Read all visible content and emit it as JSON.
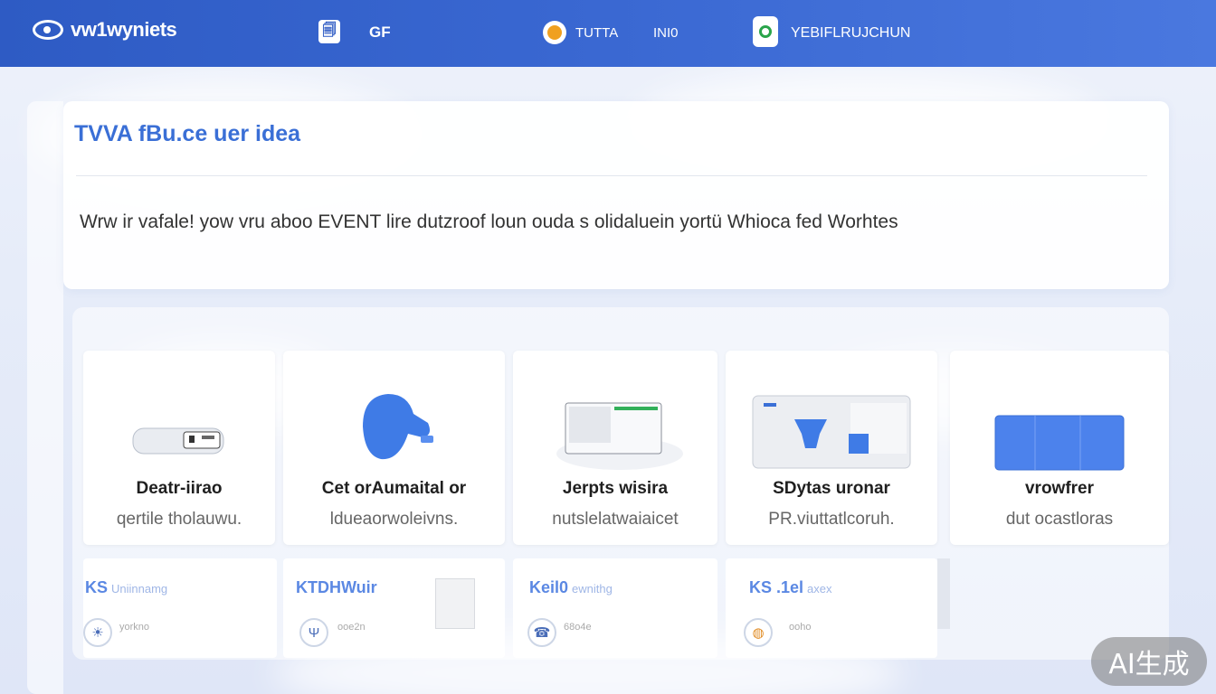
{
  "header": {
    "brand": "vw1wyniets",
    "nav_icon_glyph": "🗐",
    "nav_label": "GF",
    "links": [
      "TUTTA",
      "INI0"
    ],
    "user_name": "YEBIFLRUJCHUN"
  },
  "intro": {
    "title": "TVVA fBu.ce uer idea",
    "text": "Wrw ir vafale! yow vru aboo EVENT lire dutzroof loun ouda s olidaluein yortü Whioca fed Worhtes"
  },
  "products": [
    {
      "title": "Deatr-iirao",
      "subtitle": "qertile tholauwu."
    },
    {
      "title": "Cet orAumaital or",
      "subtitle": "ldueaorwoleivns."
    },
    {
      "title": "Jerpts wisira",
      "subtitle": "nutslelatwaiaicet"
    },
    {
      "title": "SDytas uronar",
      "subtitle": "PR.viuttatlcoruh."
    },
    {
      "title": "vrowfrer",
      "subtitle": "dut ocastloras"
    }
  ],
  "stats": [
    {
      "head": "KS",
      "small": "Uniinnamg",
      "value": "yorkno",
      "icon_glyph": "☀"
    },
    {
      "head": "KTDHWuir",
      "small": "",
      "value": "ooe2n",
      "icon_glyph": "Ψ"
    },
    {
      "head": "Keil0",
      "small": "ewnithg",
      "value": "68o4e",
      "icon_glyph": "☎"
    },
    {
      "head": "KS .1el",
      "small": "axex",
      "value": "ooho",
      "icon_glyph": "◍"
    }
  ],
  "watermark": "AI生成",
  "colors": {
    "topbar": "#3a68d2",
    "accent": "#3a6fd6",
    "status_orange": "#f0a020",
    "avatar_green": "#2aa44a"
  }
}
